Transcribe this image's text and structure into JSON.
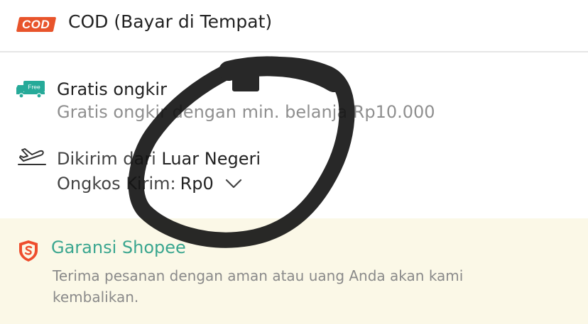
{
  "payment": {
    "badge": "COD",
    "label": "COD (Bayar di Tempat)"
  },
  "shipping": {
    "icon": "free-shipping-truck-icon",
    "icon_text": "Free",
    "title": "Gratis ongkir",
    "subtitle": "Gratis ongkir dengan min. belanja Rp10.000"
  },
  "origin": {
    "icon": "airplane-icon",
    "prefix": "Dikirim dari",
    "place": "Luar Negeri",
    "fee_label": "Ongkos Kirim:",
    "fee_value": "Rp0"
  },
  "guarantee": {
    "icon": "shield-icon",
    "title": "Garansi Shopee",
    "description": "Terima pesanan dengan aman atau uang Anda akan kami kembalikan."
  },
  "colors": {
    "cod_badge": "#e8542b",
    "guarantee_bg": "#fbf8e7",
    "guarantee_title": "#3aa68f",
    "free_truck": "#26aa99",
    "shield": "#ee4d2d",
    "marker": "#111111"
  }
}
